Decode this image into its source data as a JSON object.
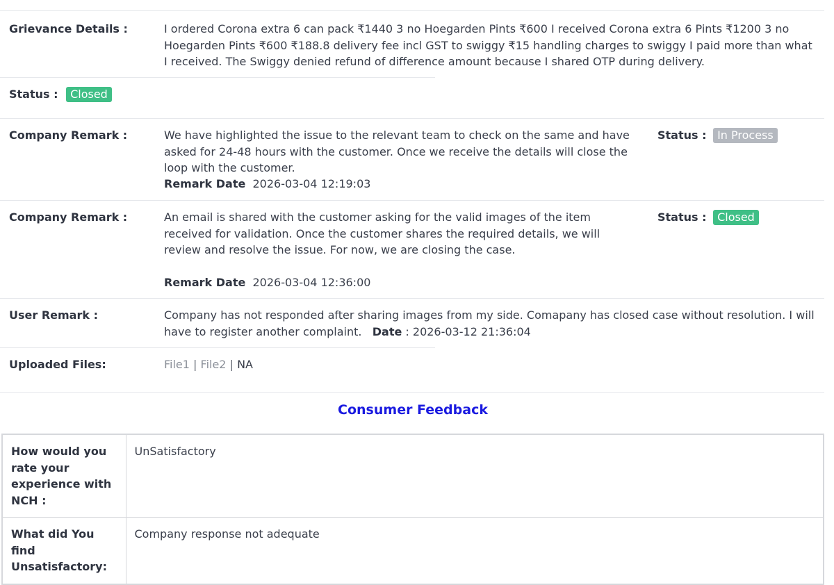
{
  "grievance": {
    "label": "Grievance Details :",
    "text": "I ordered Corona extra 6 can pack ₹1440 3 no Hoegarden Pints ₹600 I received Corona extra 6 Pints ₹1200 3 no Hoegarden Pints ₹600 ₹188.8 delivery fee incl GST to swiggy ₹15 handling charges to swiggy I paid more than what I received. The Swiggy denied refund of difference amount because I shared OTP during delivery."
  },
  "status": {
    "label": "Status :",
    "value": "Closed"
  },
  "remarks": [
    {
      "label": "Company Remark :",
      "text": "We have highlighted the issue to the relevant team to check on the same and have asked for 24-48 hours with the customer. Once we receive the details will close the loop with the customer.",
      "date_label": "Remark Date",
      "date": "2026-03-04 12:19:03",
      "status_label": "Status :",
      "status": "In Process"
    },
    {
      "label": "Company Remark :",
      "text": "An email is shared with the customer asking for the valid images of the item received for validation. Once the customer shares the required details, we will review and resolve the issue. For now, we are closing the case.",
      "date_label": "Remark Date",
      "date": "2026-03-04 12:36:00",
      "status_label": "Status :",
      "status": "Closed"
    }
  ],
  "user_remark": {
    "label": "User Remark :",
    "text": "Company has not responded after sharing images from my side. Comapany has closed case without resolution. I will have to register another complaint.",
    "date_label": "Date",
    "date": ": 2026-03-12 21:36:04"
  },
  "uploaded": {
    "label": "Uploaded Files:",
    "file1": "File1",
    "file2": "File2",
    "na": "NA",
    "separator": "|"
  },
  "feedback": {
    "title": "Consumer Feedback",
    "rows": [
      {
        "question": "How would you rate your experience with NCH :",
        "answer": "UnSatisfactory"
      },
      {
        "question": "What did You find Unsatisfactory:",
        "answer": "Company response not adequate"
      }
    ]
  },
  "colors": {
    "closed_badge": "#3fbf86",
    "in_process_badge": "#b4b8bf",
    "feedback_title": "#1a1ae0"
  }
}
